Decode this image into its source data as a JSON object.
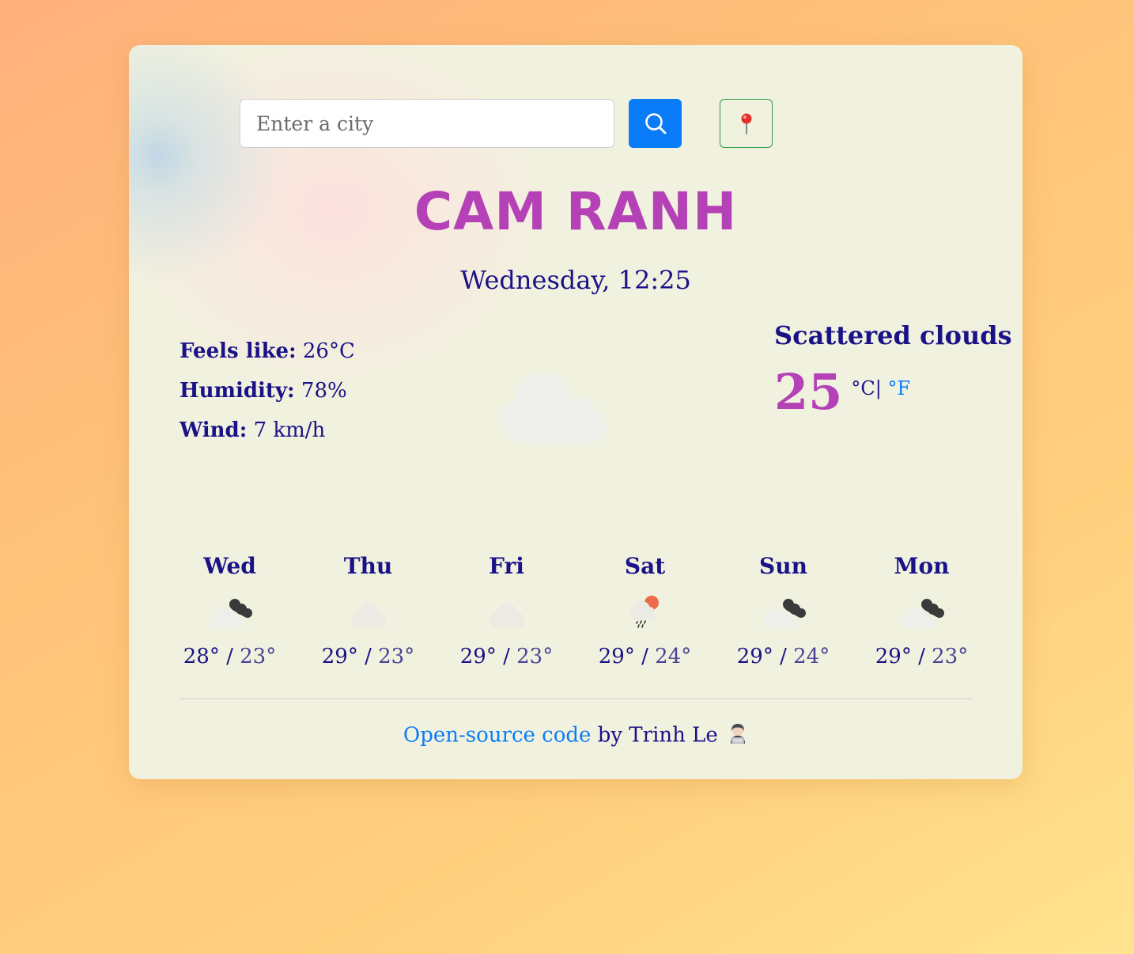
{
  "search": {
    "placeholder": "Enter a city",
    "value": ""
  },
  "icons": {
    "search_button": "search-icon",
    "location_button": "map-pin-icon",
    "current_weather": "cloud-icon"
  },
  "city": "CAM RANH",
  "datetime": "Wednesday, 12:25",
  "details": {
    "feels_like_label": "Feels like:",
    "feels_like_value": "26°C",
    "humidity_label": "Humidity:",
    "humidity_value": "78%",
    "wind_label": "Wind:",
    "wind_value": "7 km/h"
  },
  "current": {
    "description": "Scattered clouds",
    "temperature": "25",
    "unit_celsius": "°C|",
    "unit_fahrenheit": "°F"
  },
  "forecast": [
    {
      "day": "Wed",
      "icon": "broken-clouds-icon",
      "max": "28°",
      "separator": "/",
      "min": "23°"
    },
    {
      "day": "Thu",
      "icon": "few-clouds-icon",
      "max": "29°",
      "separator": "/",
      "min": "23°"
    },
    {
      "day": "Fri",
      "icon": "few-clouds-icon",
      "max": "29°",
      "separator": "/",
      "min": "23°"
    },
    {
      "day": "Sat",
      "icon": "rain-icon",
      "max": "29°",
      "separator": "/",
      "min": "24°"
    },
    {
      "day": "Sun",
      "icon": "broken-clouds-icon",
      "max": "29°",
      "separator": "/",
      "min": "24°"
    },
    {
      "day": "Mon",
      "icon": "broken-clouds-icon",
      "max": "29°",
      "separator": "/",
      "min": "23°"
    }
  ],
  "footer": {
    "link_text": "Open-source code",
    "by_text": " by Trinh Le ",
    "emoji": "technologist-icon"
  },
  "colors": {
    "accent": "#b442b6",
    "text": "#1a1287",
    "link": "#0a7cf7",
    "search_button": "#0a7cf7",
    "location_border": "#2f9a44"
  }
}
